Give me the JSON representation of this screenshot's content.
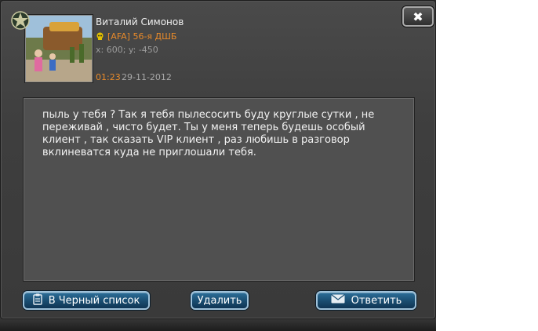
{
  "sender": {
    "name": "Виталий Симонов",
    "clan": "[AFA] 56-я ДШБ",
    "coords": "x: 600; y: -450"
  },
  "message": {
    "time": "01:23",
    "date": "29-11-2012",
    "text": "пыль у тебя ? Так я тебя пылесосить буду круглые сутки , не переживай , чисто будет. Ты у меня теперь будешь особый клиент , так сказать VIP клиент , раз любишь в разговор вклиневатся куда не приглошали тебя."
  },
  "window": {
    "close_label": "✖"
  },
  "buttons": {
    "blacklist": "В Черный список",
    "delete": "Удалить",
    "reply": "Ответить"
  },
  "icons": {
    "emblem": "clan-star-emblem",
    "clan": "skull-icon",
    "blacklist": "clipboard-icon",
    "reply": "envelope-icon"
  },
  "colors": {
    "accent": "#e88a2a",
    "button": "#1b4f73",
    "panel": "#3e3e3e"
  }
}
